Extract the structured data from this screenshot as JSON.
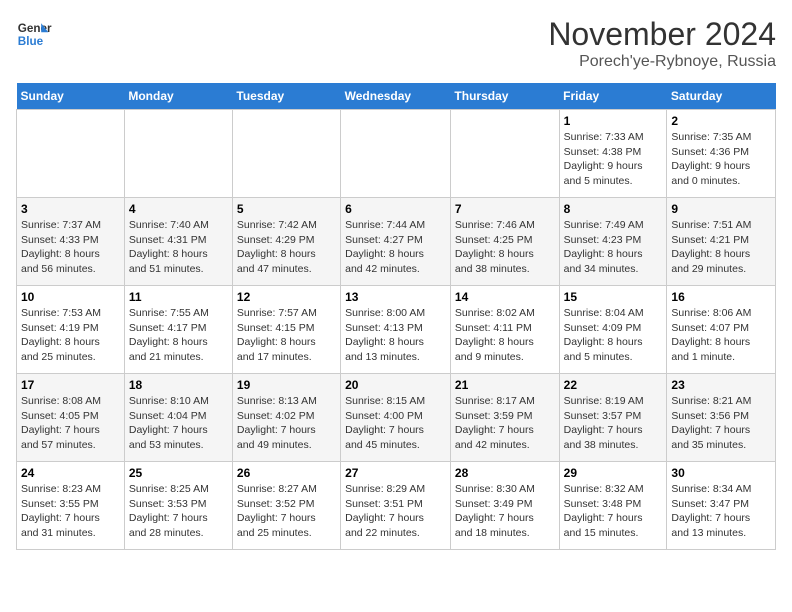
{
  "logo": {
    "line1": "General",
    "line2": "Blue"
  },
  "title": "November 2024",
  "location": "Porech'ye-Rybnoye, Russia",
  "days_of_week": [
    "Sunday",
    "Monday",
    "Tuesday",
    "Wednesday",
    "Thursday",
    "Friday",
    "Saturday"
  ],
  "weeks": [
    [
      {
        "day": "",
        "info": ""
      },
      {
        "day": "",
        "info": ""
      },
      {
        "day": "",
        "info": ""
      },
      {
        "day": "",
        "info": ""
      },
      {
        "day": "",
        "info": ""
      },
      {
        "day": "1",
        "info": "Sunrise: 7:33 AM\nSunset: 4:38 PM\nDaylight: 9 hours\nand 5 minutes."
      },
      {
        "day": "2",
        "info": "Sunrise: 7:35 AM\nSunset: 4:36 PM\nDaylight: 9 hours\nand 0 minutes."
      }
    ],
    [
      {
        "day": "3",
        "info": "Sunrise: 7:37 AM\nSunset: 4:33 PM\nDaylight: 8 hours\nand 56 minutes."
      },
      {
        "day": "4",
        "info": "Sunrise: 7:40 AM\nSunset: 4:31 PM\nDaylight: 8 hours\nand 51 minutes."
      },
      {
        "day": "5",
        "info": "Sunrise: 7:42 AM\nSunset: 4:29 PM\nDaylight: 8 hours\nand 47 minutes."
      },
      {
        "day": "6",
        "info": "Sunrise: 7:44 AM\nSunset: 4:27 PM\nDaylight: 8 hours\nand 42 minutes."
      },
      {
        "day": "7",
        "info": "Sunrise: 7:46 AM\nSunset: 4:25 PM\nDaylight: 8 hours\nand 38 minutes."
      },
      {
        "day": "8",
        "info": "Sunrise: 7:49 AM\nSunset: 4:23 PM\nDaylight: 8 hours\nand 34 minutes."
      },
      {
        "day": "9",
        "info": "Sunrise: 7:51 AM\nSunset: 4:21 PM\nDaylight: 8 hours\nand 29 minutes."
      }
    ],
    [
      {
        "day": "10",
        "info": "Sunrise: 7:53 AM\nSunset: 4:19 PM\nDaylight: 8 hours\nand 25 minutes."
      },
      {
        "day": "11",
        "info": "Sunrise: 7:55 AM\nSunset: 4:17 PM\nDaylight: 8 hours\nand 21 minutes."
      },
      {
        "day": "12",
        "info": "Sunrise: 7:57 AM\nSunset: 4:15 PM\nDaylight: 8 hours\nand 17 minutes."
      },
      {
        "day": "13",
        "info": "Sunrise: 8:00 AM\nSunset: 4:13 PM\nDaylight: 8 hours\nand 13 minutes."
      },
      {
        "day": "14",
        "info": "Sunrise: 8:02 AM\nSunset: 4:11 PM\nDaylight: 8 hours\nand 9 minutes."
      },
      {
        "day": "15",
        "info": "Sunrise: 8:04 AM\nSunset: 4:09 PM\nDaylight: 8 hours\nand 5 minutes."
      },
      {
        "day": "16",
        "info": "Sunrise: 8:06 AM\nSunset: 4:07 PM\nDaylight: 8 hours\nand 1 minute."
      }
    ],
    [
      {
        "day": "17",
        "info": "Sunrise: 8:08 AM\nSunset: 4:05 PM\nDaylight: 7 hours\nand 57 minutes."
      },
      {
        "day": "18",
        "info": "Sunrise: 8:10 AM\nSunset: 4:04 PM\nDaylight: 7 hours\nand 53 minutes."
      },
      {
        "day": "19",
        "info": "Sunrise: 8:13 AM\nSunset: 4:02 PM\nDaylight: 7 hours\nand 49 minutes."
      },
      {
        "day": "20",
        "info": "Sunrise: 8:15 AM\nSunset: 4:00 PM\nDaylight: 7 hours\nand 45 minutes."
      },
      {
        "day": "21",
        "info": "Sunrise: 8:17 AM\nSunset: 3:59 PM\nDaylight: 7 hours\nand 42 minutes."
      },
      {
        "day": "22",
        "info": "Sunrise: 8:19 AM\nSunset: 3:57 PM\nDaylight: 7 hours\nand 38 minutes."
      },
      {
        "day": "23",
        "info": "Sunrise: 8:21 AM\nSunset: 3:56 PM\nDaylight: 7 hours\nand 35 minutes."
      }
    ],
    [
      {
        "day": "24",
        "info": "Sunrise: 8:23 AM\nSunset: 3:55 PM\nDaylight: 7 hours\nand 31 minutes."
      },
      {
        "day": "25",
        "info": "Sunrise: 8:25 AM\nSunset: 3:53 PM\nDaylight: 7 hours\nand 28 minutes."
      },
      {
        "day": "26",
        "info": "Sunrise: 8:27 AM\nSunset: 3:52 PM\nDaylight: 7 hours\nand 25 minutes."
      },
      {
        "day": "27",
        "info": "Sunrise: 8:29 AM\nSunset: 3:51 PM\nDaylight: 7 hours\nand 22 minutes."
      },
      {
        "day": "28",
        "info": "Sunrise: 8:30 AM\nSunset: 3:49 PM\nDaylight: 7 hours\nand 18 minutes."
      },
      {
        "day": "29",
        "info": "Sunrise: 8:32 AM\nSunset: 3:48 PM\nDaylight: 7 hours\nand 15 minutes."
      },
      {
        "day": "30",
        "info": "Sunrise: 8:34 AM\nSunset: 3:47 PM\nDaylight: 7 hours\nand 13 minutes."
      }
    ]
  ]
}
